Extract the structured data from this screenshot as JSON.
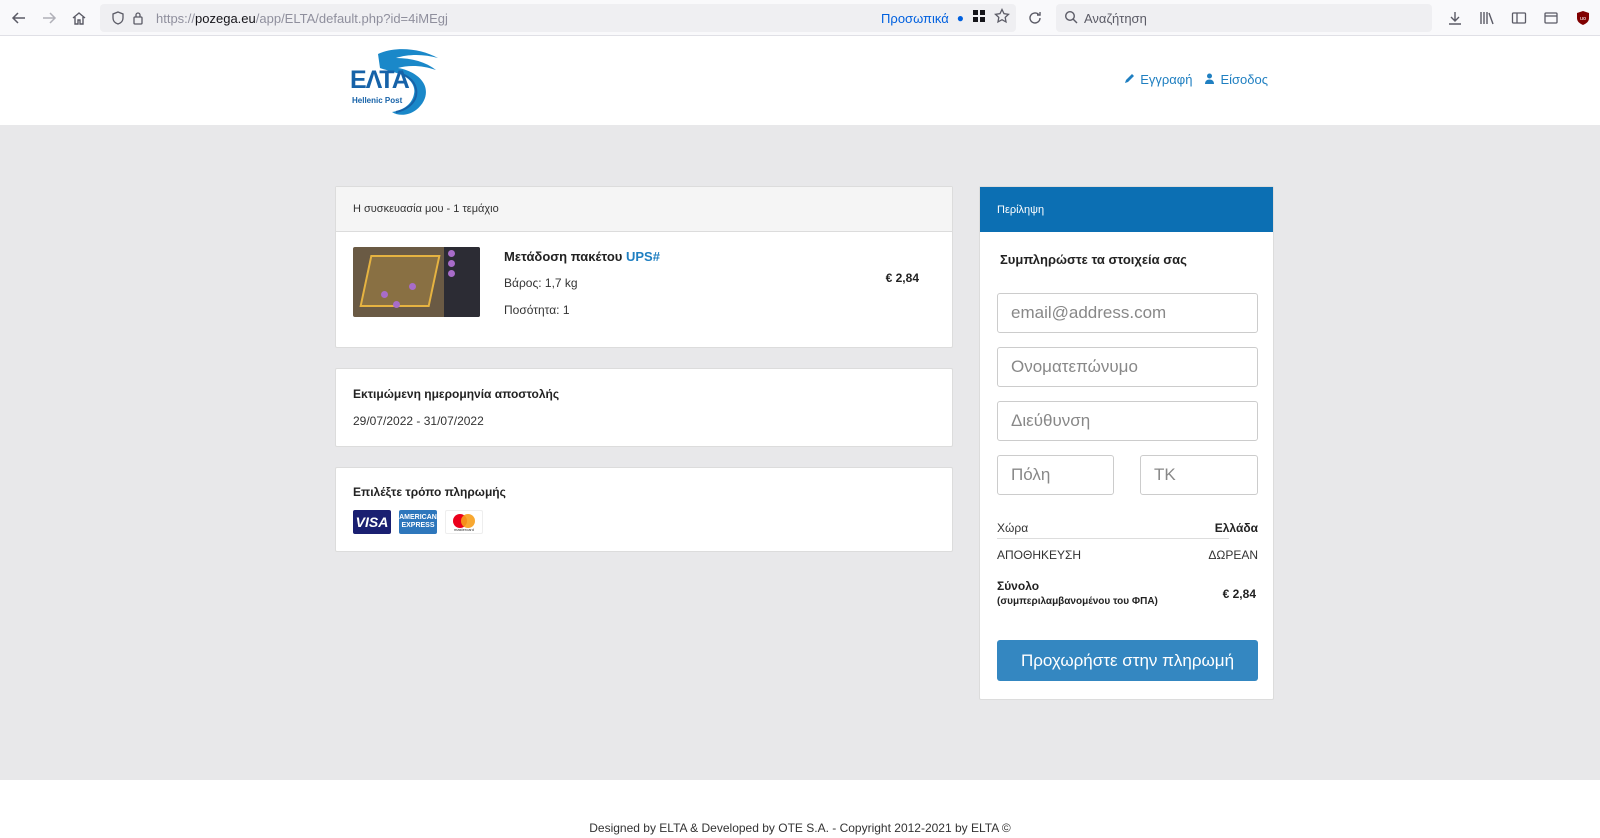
{
  "browser": {
    "url_prefix": "https://",
    "url_domain": "pozega.eu",
    "url_path": "/app/ELTA/default.php?id=4iMEgj",
    "personal_label": "Προσωπικά",
    "search_placeholder": "Αναζήτηση"
  },
  "header": {
    "logo_text": "ΕΛΤΑ",
    "logo_subtitle": "Hellenic Post",
    "register_label": "Εγγραφή",
    "login_label": "Είσοδος",
    "link_color": "#1f7fc1"
  },
  "package": {
    "header": "Η συσκευασία μου - 1 τεμάχιο",
    "title_prefix": "Μετάδοση πακέτου ",
    "title_highlight": "UPS#",
    "weight": "Βάρος: 1,7 kg",
    "quantity": "Ποσότητα: 1",
    "price": "€ 2,84"
  },
  "delivery": {
    "title": "Εκτιμώμενη ημερομηνία αποστολής",
    "dates": "29/07/2022 - 31/07/2022"
  },
  "payment": {
    "title": "Επιλέξτε τρόπο πληρωμής",
    "cards": [
      "VISA",
      "AMERICAN EXPRESS",
      "mastercard"
    ]
  },
  "summary": {
    "header": "Περίληψη",
    "header_color": "#0c6fb3",
    "form_title": "Συμπληρώστε τα στοιχεία σας",
    "email_placeholder": "email@address.com",
    "name_placeholder": "Ονοματεπώνυμο",
    "address_placeholder": "Διεύθυνση",
    "city_placeholder": "Πόλη",
    "zip_placeholder": "ΤΚ",
    "country_label": "Χώρα",
    "country_value": "Ελλάδα",
    "shipping_label": "ΑΠΟΘΗΚΕΥΣΗ",
    "shipping_value": "ΔΩΡΕΑΝ",
    "total_label": "Σύνολο",
    "total_note": "(συμπεριλαμβανομένου του ΦΠΑ)",
    "total_value": "€ 2,84",
    "pay_button": "Προχωρήστε στην πληρωμή",
    "button_color": "#3487c1"
  },
  "footer": {
    "text": "Designed by ELTA & Developed by OTE S.A. - Copyright 2012-2021 by ELTA ©"
  }
}
